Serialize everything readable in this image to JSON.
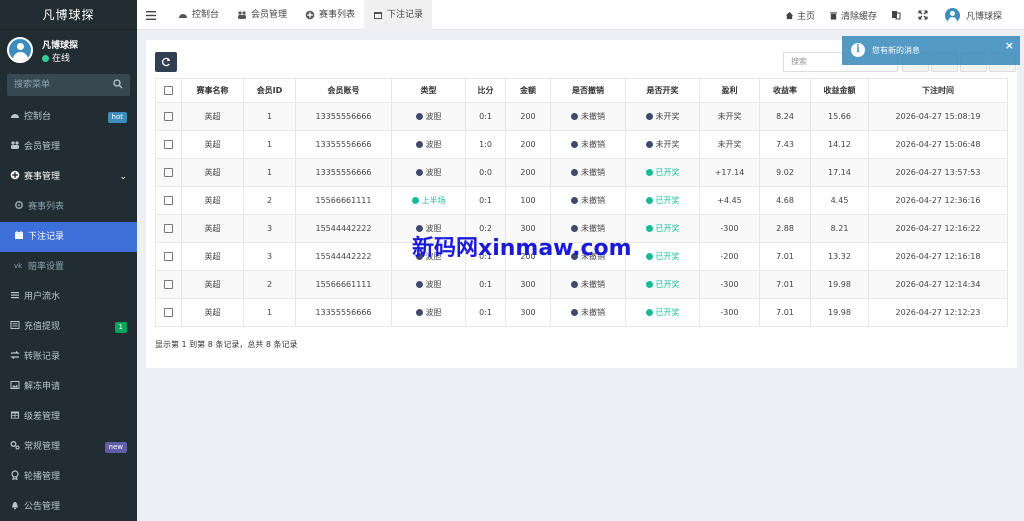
{
  "app": {
    "title": "凡博球探"
  },
  "user": {
    "name": "凡博球探",
    "status": "在线"
  },
  "sidebar": {
    "search_placeholder": "搜索菜单",
    "items": [
      {
        "label": "控制台",
        "badge": "hot",
        "icon": "dashboard-icon"
      },
      {
        "label": "会员管理",
        "icon": "users-icon"
      },
      {
        "label": "赛事管理",
        "icon": "circle-plus-icon"
      },
      {
        "label": "赛事列表",
        "icon": "gear-icon"
      },
      {
        "label": "下注记录",
        "icon": "calendar-icon"
      },
      {
        "label": "赔率设置",
        "icon": "vk-icon"
      },
      {
        "label": "用户流水",
        "icon": "list-icon"
      },
      {
        "label": "充值提现",
        "badge": "1",
        "icon": "list-alt-icon"
      },
      {
        "label": "转账记录",
        "icon": "exchange-icon"
      },
      {
        "label": "解冻申请",
        "icon": "image-icon"
      },
      {
        "label": "级差管理",
        "icon": "table-icon"
      },
      {
        "label": "常规管理",
        "badge": "new",
        "icon": "cogs-icon"
      },
      {
        "label": "轮播管理",
        "icon": "award-icon"
      },
      {
        "label": "公告管理",
        "icon": "bell-icon"
      }
    ]
  },
  "tabs": [
    {
      "label": "控制台",
      "icon": "dashboard-icon"
    },
    {
      "label": "会员管理",
      "icon": "users-icon"
    },
    {
      "label": "赛事列表",
      "icon": "circle-plus-icon"
    },
    {
      "label": "下注记录",
      "icon": "calendar-icon"
    }
  ],
  "topright": {
    "home": "主页",
    "clear_cache": "清除缓存",
    "user": "凡博球探"
  },
  "toast": {
    "message": "您有新的消息"
  },
  "toolbar": {
    "search_placeholder": "搜索"
  },
  "table": {
    "headers": [
      "赛事名称",
      "会员ID",
      "会员账号",
      "类型",
      "比分",
      "金额",
      "是否撤销",
      "是否开奖",
      "盈利",
      "收益率",
      "收益金额",
      "下注时间"
    ],
    "rows": [
      {
        "match": "英超",
        "id": "1",
        "account": "13355556666",
        "type": "波胆",
        "type_color": "#3d4a6b",
        "score": "0:1",
        "amount": "200",
        "revoked": "未撤销",
        "drawn": "未开奖",
        "drawn_color": "#3d4a6b",
        "profit": "未开奖",
        "rate": "8.24",
        "income": "15.66",
        "time": "2026-04-27 15:08:19"
      },
      {
        "match": "英超",
        "id": "1",
        "account": "13355556666",
        "type": "波胆",
        "type_color": "#3d4a6b",
        "score": "1:0",
        "amount": "200",
        "revoked": "未撤销",
        "drawn": "未开奖",
        "drawn_color": "#3d4a6b",
        "profit": "未开奖",
        "rate": "7.43",
        "income": "14.12",
        "time": "2026-04-27 15:06:48"
      },
      {
        "match": "英超",
        "id": "1",
        "account": "13355556666",
        "type": "波胆",
        "type_color": "#3d4a6b",
        "score": "0:0",
        "amount": "200",
        "revoked": "未撤销",
        "drawn": "已开奖",
        "drawn_color": "#18bc9c",
        "profit": "+17.14",
        "rate": "9.02",
        "income": "17.14",
        "time": "2026-04-27 13:57:53"
      },
      {
        "match": "英超",
        "id": "2",
        "account": "15566661111",
        "type": "上半场",
        "type_color": "#18bc9c",
        "score": "0:1",
        "amount": "100",
        "revoked": "未撤销",
        "drawn": "已开奖",
        "drawn_color": "#18bc9c",
        "profit": "+4.45",
        "rate": "4.68",
        "income": "4.45",
        "time": "2026-04-27 12:36:16"
      },
      {
        "match": "英超",
        "id": "3",
        "account": "15544442222",
        "type": "波胆",
        "type_color": "#3d4a6b",
        "score": "0:2",
        "amount": "300",
        "revoked": "未撤销",
        "drawn": "已开奖",
        "drawn_color": "#18bc9c",
        "profit": "-300",
        "rate": "2.88",
        "income": "8.21",
        "time": "2026-04-27 12:16:22"
      },
      {
        "match": "英超",
        "id": "3",
        "account": "15544442222",
        "type": "波胆",
        "type_color": "#3d4a6b",
        "score": "0:1",
        "amount": "200",
        "revoked": "未撤销",
        "drawn": "已开奖",
        "drawn_color": "#18bc9c",
        "profit": "-200",
        "rate": "7.01",
        "income": "13.32",
        "time": "2026-04-27 12:16:18"
      },
      {
        "match": "英超",
        "id": "2",
        "account": "15566661111",
        "type": "波胆",
        "type_color": "#3d4a6b",
        "score": "0:1",
        "amount": "300",
        "revoked": "未撤销",
        "drawn": "已开奖",
        "drawn_color": "#18bc9c",
        "profit": "-300",
        "rate": "7.01",
        "income": "19.98",
        "time": "2026-04-27 12:14:34"
      },
      {
        "match": "英超",
        "id": "1",
        "account": "13355556666",
        "type": "波胆",
        "type_color": "#3d4a6b",
        "score": "0:1",
        "amount": "300",
        "revoked": "未撤销",
        "drawn": "已开奖",
        "drawn_color": "#18bc9c",
        "profit": "-300",
        "rate": "7.01",
        "income": "19.98",
        "time": "2026-04-27 12:12:23"
      }
    ],
    "footer": "显示第 1 到第 8 条记录，总共 8 条记录"
  },
  "watermark": "新码网xinmaw.com",
  "colors": {
    "sidebar_bg": "#222d32",
    "active_item": "#3c6fd9",
    "accent": "#3c8dbc",
    "status_dark": "#3d4a6b",
    "status_green": "#18bc9c"
  }
}
